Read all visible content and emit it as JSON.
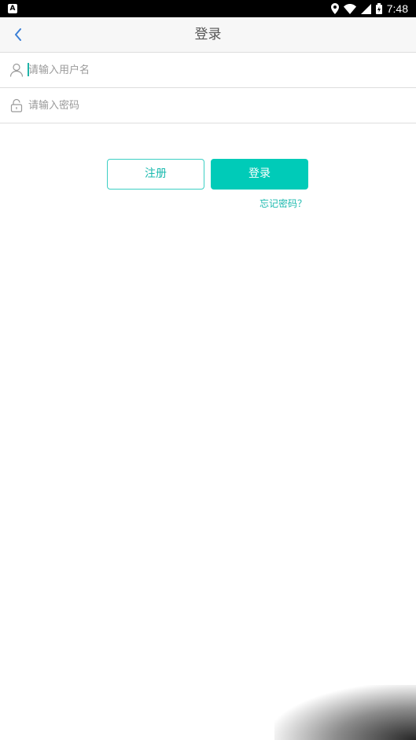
{
  "status_bar": {
    "time": "7:48",
    "icons": [
      "location-icon",
      "wifi-icon",
      "signal-icon",
      "battery-icon"
    ]
  },
  "header": {
    "title": "登录",
    "back_icon": "chevron-left-icon"
  },
  "form": {
    "username": {
      "placeholder": "请输入用户名",
      "value": "",
      "icon": "user-icon"
    },
    "password": {
      "placeholder": "请输入密码",
      "value": "",
      "icon": "lock-icon"
    }
  },
  "actions": {
    "register_label": "注册",
    "login_label": "登录",
    "forgot_label": "忘记密码？"
  },
  "colors": {
    "accent": "#00cbb8",
    "link": "#1bb9ae",
    "back_icon": "#3b7fd6"
  }
}
